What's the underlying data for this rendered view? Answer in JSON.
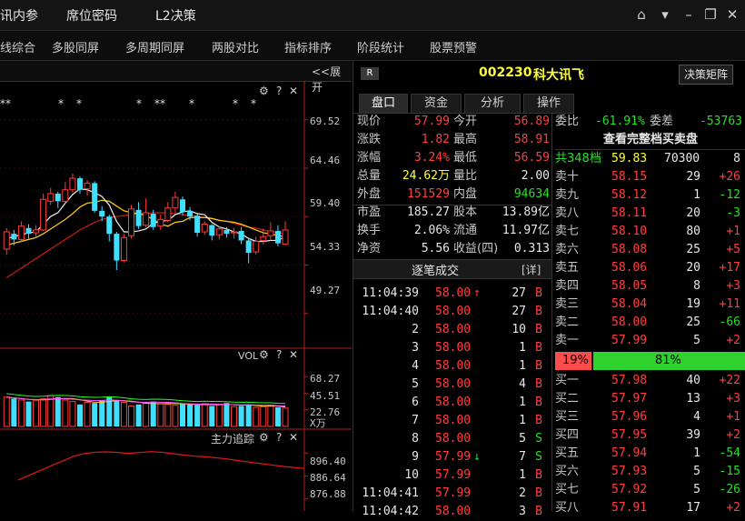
{
  "topbar": {
    "menus": [
      "讯内参",
      "席位密码",
      "L2决策"
    ],
    "buttons": [
      "home",
      "dropdown",
      "minimize",
      "restore",
      "close"
    ]
  },
  "navbar": {
    "items": [
      "线综合",
      "多股同屏",
      "多周期同屏",
      "两股对比",
      "指标排序",
      "阶段统计",
      "股票预警"
    ]
  },
  "chart": {
    "expand_label": "<<展开",
    "price_axis": [
      "69.52",
      "64.46",
      "59.40",
      "54.33",
      "49.27"
    ],
    "stars": [
      "**",
      "*",
      "*",
      "*",
      "**",
      "*",
      "*",
      "*"
    ],
    "vol_title": "VOL",
    "vol_axis": [
      "68.27",
      "45.51",
      "22.76",
      "X万"
    ],
    "main_force_title": "主力追踪",
    "main_force_axis": [
      "896.40",
      "886.64",
      "876.88"
    ]
  },
  "chart_data": {
    "type": "candlestick",
    "title": "",
    "price_axis_ticks": [
      69.52,
      64.46,
      59.4,
      54.33,
      49.27
    ],
    "ylim": [
      46.0,
      71.5
    ],
    "candles": [
      [
        56.0,
        57.8,
        55.4,
        58.2
      ],
      [
        57.6,
        57.0,
        56.4,
        58.0
      ],
      [
        57.0,
        58.4,
        56.8,
        58.9
      ],
      [
        58.2,
        57.6,
        57.1,
        58.6
      ],
      [
        57.7,
        58.0,
        57.2,
        58.5
      ],
      [
        58.0,
        61.2,
        57.9,
        61.8
      ],
      [
        61.0,
        61.8,
        60.6,
        62.4
      ],
      [
        61.8,
        61.0,
        60.3,
        62.0
      ],
      [
        61.0,
        62.2,
        60.8,
        63.0
      ],
      [
        62.2,
        63.4,
        61.9,
        63.9
      ],
      [
        63.4,
        62.2,
        61.8,
        63.6
      ],
      [
        62.3,
        62.9,
        61.6,
        63.2
      ],
      [
        62.9,
        60.0,
        59.8,
        63.1
      ],
      [
        60.0,
        59.4,
        58.9,
        60.5
      ],
      [
        59.4,
        57.6,
        56.8,
        59.6
      ],
      [
        57.6,
        54.8,
        53.8,
        57.8
      ],
      [
        54.8,
        57.2,
        54.6,
        57.6
      ],
      [
        57.4,
        60.2,
        57.1,
        60.6
      ],
      [
        60.1,
        58.4,
        58.1,
        60.9
      ],
      [
        58.5,
        59.8,
        58.3,
        61.3
      ],
      [
        59.7,
        58.3,
        58.0,
        60.1
      ],
      [
        58.4,
        59.1,
        58.0,
        59.6
      ],
      [
        59.0,
        60.3,
        58.8,
        60.9
      ],
      [
        60.3,
        61.4,
        59.8,
        62.0
      ],
      [
        61.2,
        59.9,
        59.5,
        61.5
      ],
      [
        60.0,
        59.4,
        59.0,
        60.4
      ],
      [
        59.5,
        57.7,
        57.3,
        59.7
      ],
      [
        57.8,
        58.6,
        57.5,
        58.9
      ],
      [
        58.5,
        57.4,
        56.9,
        58.6
      ],
      [
        57.5,
        58.1,
        57.0,
        58.4
      ],
      [
        58.0,
        57.6,
        57.2,
        58.3
      ],
      [
        57.7,
        57.8,
        57.1,
        58.2
      ],
      [
        57.9,
        56.9,
        56.5,
        58.3
      ],
      [
        56.9,
        55.6,
        54.5,
        57.2
      ],
      [
        55.7,
        56.8,
        55.4,
        57.3
      ],
      [
        56.9,
        57.3,
        56.5,
        58.1
      ],
      [
        57.4,
        57.9,
        56.9,
        58.8
      ],
      [
        57.9,
        56.6,
        56.3,
        58.5
      ],
      [
        56.5,
        57.99,
        56.4,
        58.91
      ]
    ],
    "ma5": [
      57.1,
      57.3,
      57.5,
      57.7,
      57.8,
      58.6,
      59.4,
      59.8,
      60.8,
      61.7,
      62.3,
      62.2,
      61.9,
      61.5,
      60.6,
      58.9,
      57.8,
      57.8,
      57.9,
      58.1,
      58.7,
      58.9,
      59.0,
      59.6,
      59.9,
      60.0,
      59.7,
      59.6,
      58.8,
      58.3,
      58.1,
      57.8,
      57.6,
      57.1,
      56.8,
      56.8,
      56.9,
      56.9,
      57.3
    ],
    "ma10": [
      56.4,
      56.6,
      56.8,
      57.0,
      57.2,
      57.6,
      58.1,
      58.6,
      59.1,
      59.7,
      60.4,
      60.8,
      60.9,
      61.1,
      61.0,
      60.5,
      60.0,
      59.8,
      59.7,
      59.5,
      59.1,
      58.6,
      58.4,
      58.8,
      58.9,
      59.3,
      59.3,
      59.3,
      59.2,
      59.0,
      58.9,
      58.8,
      58.6,
      58.3,
      58.0,
      57.7,
      57.6,
      57.4,
      57.3
    ],
    "ma20": [
      53.0,
      53.5,
      54.0,
      54.5,
      55.0,
      55.5,
      56.0,
      56.5,
      57.0,
      57.5,
      58.0,
      58.4,
      58.8,
      59.1,
      59.3,
      59.4,
      59.5,
      59.6,
      59.7,
      59.7,
      59.8,
      59.8,
      59.8,
      59.7,
      59.6,
      59.5,
      59.4,
      59.3,
      59.2,
      59.0,
      58.9,
      58.7,
      58.5,
      58.3,
      58.2,
      58.0,
      57.8,
      57.7,
      57.6
    ],
    "volume_axis_ticks": [
      68.27,
      45.51,
      22.76
    ],
    "volume": [
      40,
      38,
      36,
      34,
      35,
      38,
      42,
      40,
      36,
      34,
      30,
      33,
      32,
      36,
      40,
      35,
      33,
      28,
      30,
      32,
      34,
      31,
      30,
      29,
      31,
      30,
      29,
      31,
      28,
      30,
      32,
      27,
      28,
      30,
      26,
      27,
      29,
      26,
      25
    ],
    "volume_up": [
      true,
      false,
      true,
      false,
      true,
      true,
      true,
      false,
      true,
      true,
      false,
      true,
      false,
      false,
      false,
      false,
      true,
      true,
      false,
      true,
      false,
      true,
      true,
      true,
      false,
      false,
      false,
      true,
      false,
      true,
      false,
      true,
      false,
      false,
      true,
      true,
      true,
      false,
      true
    ],
    "main_force_axis_ticks": [
      896.4,
      886.64,
      876.88
    ],
    "main_force": [
      885.0,
      887.0,
      889.0,
      891.0,
      893.0,
      895.0,
      896.2,
      896.8,
      896.9,
      896.7,
      896.3,
      896.6,
      897.0,
      896.8,
      896.2,
      895.6,
      895.1,
      894.9,
      894.4,
      893.9,
      893.2,
      892.6,
      892.0,
      891.4,
      890.8,
      890.3,
      889.9
    ]
  },
  "quote": {
    "r_badge": "R",
    "code": "002230",
    "name": "科大讯飞",
    "decision_btn": "决策矩阵",
    "tabs": [
      "盘口",
      "资金",
      "分析",
      "操作"
    ],
    "rows": [
      [
        {
          "l": "现价",
          "v": "57.99",
          "c": "redv"
        },
        {
          "l": "今开",
          "v": "56.89",
          "c": "redv"
        }
      ],
      [
        {
          "l": "涨跌",
          "v": "1.82",
          "c": "redv"
        },
        {
          "l": "最高",
          "v": "58.91",
          "c": "redv"
        }
      ],
      [
        {
          "l": "涨幅",
          "v": "3.24%",
          "c": "redv"
        },
        {
          "l": "最低",
          "v": "56.59",
          "c": "redv"
        }
      ],
      [
        {
          "l": "总量",
          "v": "24.62万",
          "c": "yelv"
        },
        {
          "l": "量比",
          "v": "2.00",
          "c": "whv"
        }
      ],
      [
        {
          "l": "外盘",
          "v": "151529",
          "c": "redv"
        },
        {
          "l": "内盘",
          "v": "94634",
          "c": "grnv"
        }
      ]
    ],
    "rows2": [
      [
        {
          "l": "市盈",
          "v": "185.27",
          "c": "whv"
        },
        {
          "l": "股本",
          "v": "13.89亿",
          "c": "whv"
        }
      ],
      [
        {
          "l": "换手",
          "v": "2.06%",
          "c": "whv"
        },
        {
          "l": "流通",
          "v": "11.97亿",
          "c": "whv"
        }
      ],
      [
        {
          "l": "净资",
          "v": "5.56",
          "c": "whv"
        },
        {
          "l": "收益(四)",
          "v": "0.313",
          "c": "whv"
        }
      ]
    ]
  },
  "ticks": {
    "title": "逐笔成交",
    "detail_btn": "[详]",
    "rows": [
      {
        "t": "11:04:39",
        "p": "58.00",
        "arrow": "↑",
        "ac": "redv",
        "v": "27",
        "bs": "B",
        "pc": "redv",
        "bc": "redv"
      },
      {
        "t": "11:04:40",
        "p": "58.00",
        "arrow": "",
        "ac": "",
        "v": "27",
        "bs": "B",
        "pc": "redv",
        "bc": "redv"
      },
      {
        "t": "2",
        "p": "58.00",
        "arrow": "",
        "ac": "",
        "v": "10",
        "bs": "B",
        "pc": "redv",
        "bc": "redv"
      },
      {
        "t": "3",
        "p": "58.00",
        "arrow": "",
        "ac": "",
        "v": "1",
        "bs": "B",
        "pc": "redv",
        "bc": "redv"
      },
      {
        "t": "4",
        "p": "58.00",
        "arrow": "",
        "ac": "",
        "v": "1",
        "bs": "B",
        "pc": "redv",
        "bc": "redv"
      },
      {
        "t": "5",
        "p": "58.00",
        "arrow": "",
        "ac": "",
        "v": "4",
        "bs": "B",
        "pc": "redv",
        "bc": "redv"
      },
      {
        "t": "6",
        "p": "58.00",
        "arrow": "",
        "ac": "",
        "v": "1",
        "bs": "B",
        "pc": "redv",
        "bc": "redv"
      },
      {
        "t": "7",
        "p": "58.00",
        "arrow": "",
        "ac": "",
        "v": "1",
        "bs": "B",
        "pc": "redv",
        "bc": "redv"
      },
      {
        "t": "8",
        "p": "58.00",
        "arrow": "",
        "ac": "",
        "v": "5",
        "bs": "S",
        "pc": "redv",
        "bc": "grnv"
      },
      {
        "t": "9",
        "p": "57.99",
        "arrow": "↓",
        "ac": "grnv",
        "v": "7",
        "bs": "S",
        "pc": "redv",
        "bc": "grnv"
      },
      {
        "t": "10",
        "p": "57.99",
        "arrow": "",
        "ac": "",
        "v": "1",
        "bs": "B",
        "pc": "redv",
        "bc": "redv"
      },
      {
        "t": "11:04:41",
        "p": "57.99",
        "arrow": "",
        "ac": "",
        "v": "2",
        "bs": "B",
        "pc": "redv",
        "bc": "redv"
      },
      {
        "t": "11:04:42",
        "p": "58.00",
        "arrow": "",
        "ac": "",
        "v": "3",
        "bs": "B",
        "pc": "redv",
        "bc": "redv"
      }
    ]
  },
  "book": {
    "weibi_label": "委比",
    "weibi_value": "-61.91%",
    "weicha_label": "委差",
    "weicha_value": "-53763",
    "full_book_link": "查看完整档买卖盘",
    "total_label": "共348档",
    "total_price": "59.83",
    "total_vol": "70300",
    "total_cnt": "8",
    "asks": [
      {
        "l": "卖十",
        "p": "58.15",
        "v": "29",
        "d": "+26",
        "dc": "redv",
        "dot": false
      },
      {
        "l": "卖九",
        "p": "58.12",
        "v": "1",
        "d": "-12",
        "dc": "grnv",
        "dot": false
      },
      {
        "l": "卖八",
        "p": "58.11",
        "v": "20",
        "d": "-3",
        "dc": "grnv",
        "dot": false
      },
      {
        "l": "卖七",
        "p": "58.10",
        "v": "80",
        "d": "+1",
        "dc": "redv",
        "dot": true
      },
      {
        "l": "卖六",
        "p": "58.08",
        "v": "25",
        "d": "+5",
        "dc": "redv",
        "dot": false
      },
      {
        "l": "卖五",
        "p": "58.06",
        "v": "20",
        "d": "+17",
        "dc": "redv",
        "dot": false
      },
      {
        "l": "卖四",
        "p": "58.05",
        "v": "8",
        "d": "+3",
        "dc": "redv",
        "dot": false
      },
      {
        "l": "卖三",
        "p": "58.04",
        "v": "19",
        "d": "+11",
        "dc": "redv",
        "dot": false
      },
      {
        "l": "卖二",
        "p": "58.00",
        "v": "25",
        "d": "-66",
        "dc": "grnv",
        "dot": false
      },
      {
        "l": "卖一",
        "p": "57.99",
        "v": "5",
        "d": "+2",
        "dc": "redv",
        "dot": false
      }
    ],
    "ratio_left": "19%",
    "ratio_right": "81%",
    "ratio_left_value": 0.19,
    "bids": [
      {
        "l": "买一",
        "p": "57.98",
        "v": "40",
        "d": "+22",
        "dc": "redv"
      },
      {
        "l": "买二",
        "p": "57.97",
        "v": "13",
        "d": "+3",
        "dc": "redv"
      },
      {
        "l": "买三",
        "p": "57.96",
        "v": "4",
        "d": "+1",
        "dc": "redv"
      },
      {
        "l": "买四",
        "p": "57.95",
        "v": "39",
        "d": "+2",
        "dc": "redv"
      },
      {
        "l": "买五",
        "p": "57.94",
        "v": "1",
        "d": "-54",
        "dc": "grnv"
      },
      {
        "l": "买六",
        "p": "57.93",
        "v": "5",
        "d": "-15",
        "dc": "grnv"
      },
      {
        "l": "买七",
        "p": "57.92",
        "v": "5",
        "d": "-26",
        "dc": "grnv"
      },
      {
        "l": "买八",
        "p": "57.91",
        "v": "17",
        "d": "+2",
        "dc": "redv"
      }
    ]
  }
}
